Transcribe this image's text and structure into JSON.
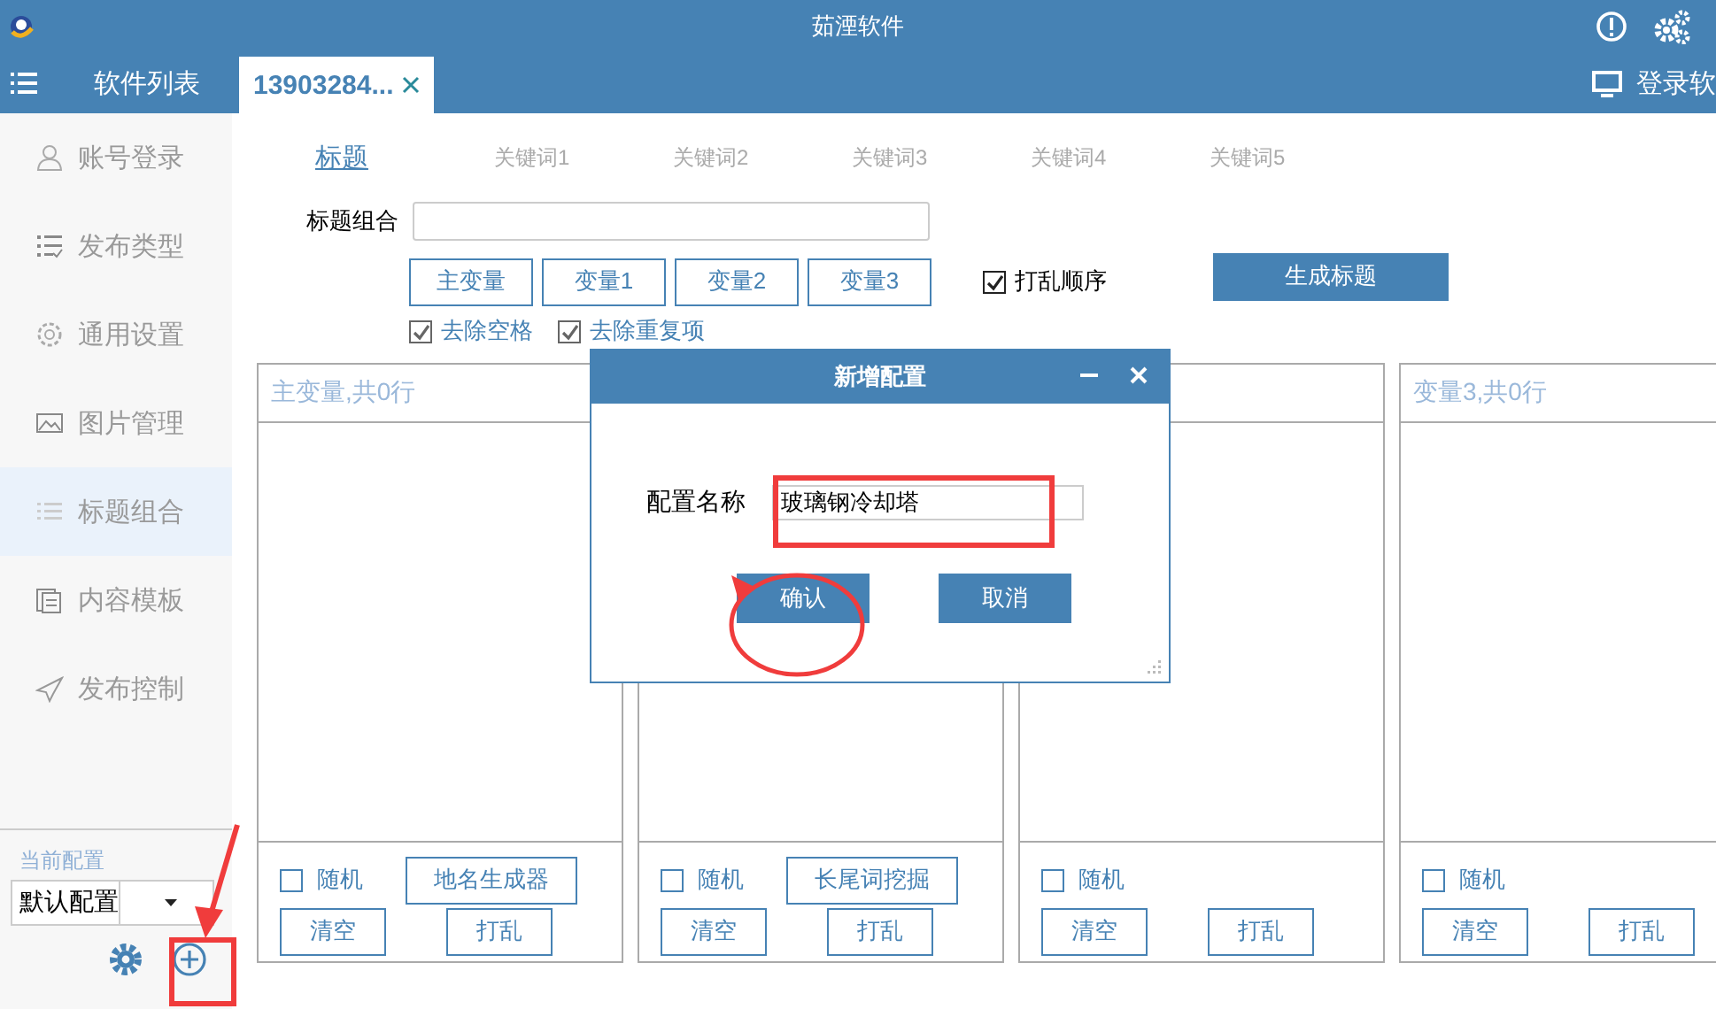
{
  "window": {
    "title": "茹湮软件"
  },
  "tabs": [
    {
      "label": "软件列表",
      "selected": false
    },
    {
      "label": "13903284...",
      "selected": true
    }
  ],
  "login_link": "登录软",
  "sidebar": {
    "items": [
      {
        "label": "账号登录",
        "selected": false
      },
      {
        "label": "发布类型",
        "selected": false
      },
      {
        "label": "通用设置",
        "selected": false
      },
      {
        "label": "图片管理",
        "selected": false
      },
      {
        "label": "标题组合",
        "selected": true
      },
      {
        "label": "内容模板",
        "selected": false
      },
      {
        "label": "发布控制",
        "selected": false
      }
    ]
  },
  "current_config": {
    "label": "当前配置",
    "value": "默认配置"
  },
  "subtabs": [
    {
      "label": "标题",
      "selected": true
    },
    {
      "label": "关键词1",
      "selected": false
    },
    {
      "label": "关键词2",
      "selected": false
    },
    {
      "label": "关键词3",
      "selected": false
    },
    {
      "label": "关键词4",
      "selected": false
    },
    {
      "label": "关键词5",
      "selected": false
    }
  ],
  "title_combo": {
    "label": "标题组合"
  },
  "variable_buttons": [
    "主变量",
    "变量1",
    "变量2",
    "变量3"
  ],
  "shuffle_order": {
    "label": "打乱顺序",
    "checked": true
  },
  "generate_button": "生成标题",
  "options": [
    {
      "label": "去除空格",
      "checked": true
    },
    {
      "label": "去除重复项",
      "checked": true
    }
  ],
  "panels": [
    {
      "header": "主变量,共0行",
      "random": {
        "label": "随机",
        "checked": false
      },
      "tool_button": "地名生成器",
      "clear_button": "清空",
      "shuffle_button": "打乱"
    },
    {
      "random": {
        "label": "随机",
        "checked": false
      },
      "tool_button": "长尾词挖掘",
      "clear_button": "清空",
      "shuffle_button": "打乱"
    },
    {
      "random": {
        "label": "随机",
        "checked": false
      },
      "clear_button": "清空",
      "shuffle_button": "打乱"
    },
    {
      "header": "变量3,共0行",
      "random": {
        "label": "随机",
        "checked": false
      },
      "clear_button": "清空",
      "shuffle_button": "打乱"
    }
  ],
  "dialog": {
    "title": "新增配置",
    "field_label": "配置名称",
    "field_value": "玻璃钢冷却塔",
    "buttons": [
      "确认",
      "取消"
    ]
  }
}
